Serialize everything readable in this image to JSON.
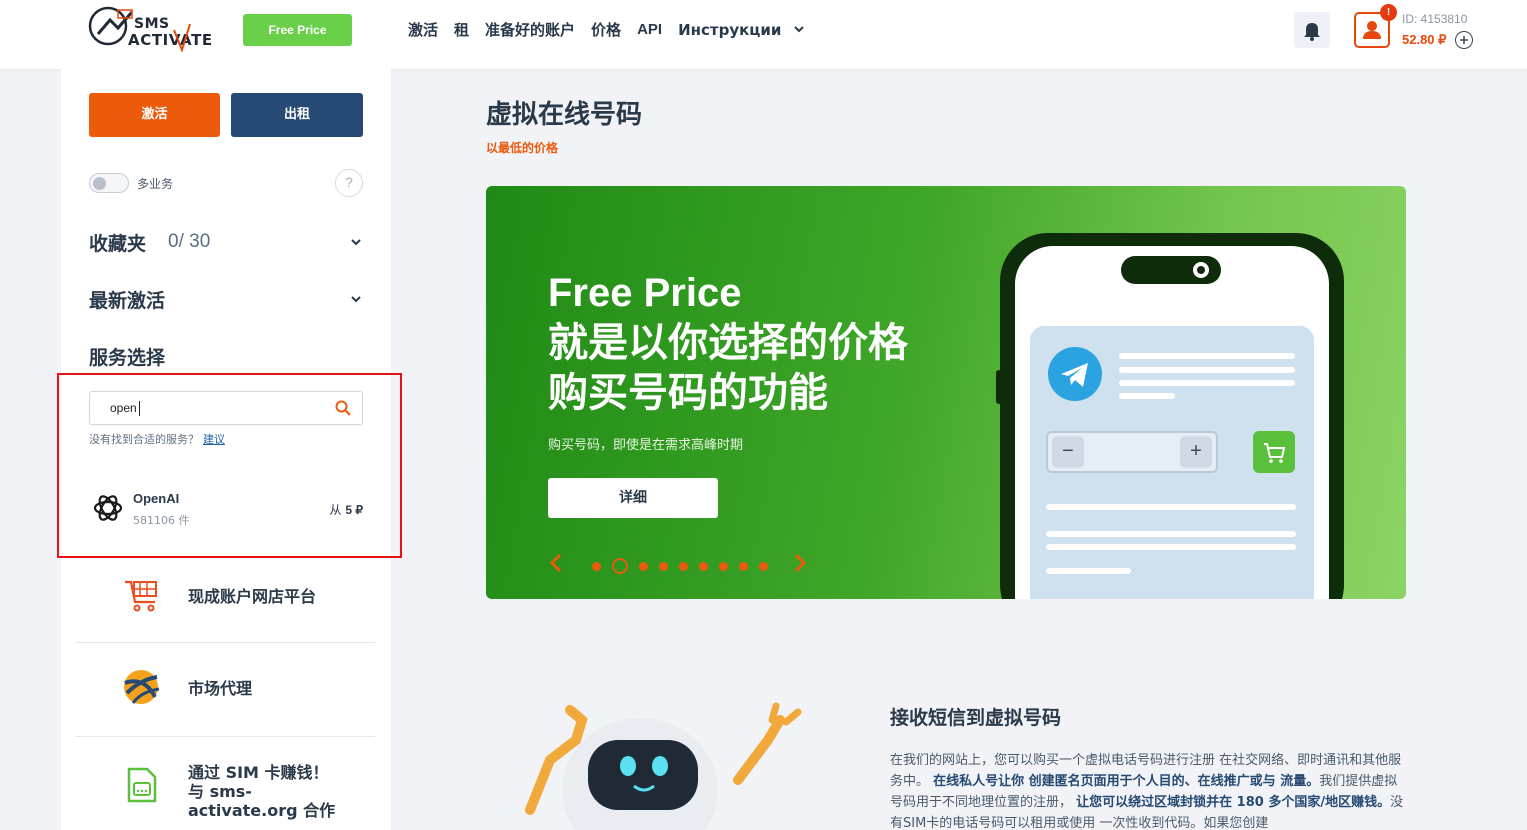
{
  "header": {
    "logo_line1": "SMS",
    "logo_line2": "ACTIVATE",
    "free_price_label": "Free Price",
    "nav": [
      "激活",
      "租",
      "准备好的账户",
      "价格",
      "API",
      "Инструкции"
    ],
    "user_id": "ID: 4153810",
    "balance": "52.80 ₽",
    "notification_badge": "!"
  },
  "sidebar": {
    "activate_label": "激活",
    "rent_label": "出租",
    "multi_service_label": "多业务",
    "help_label": "?",
    "favorites_label": "收藏夹",
    "favorites_count": "0/ 30",
    "recent_label": "最新激活",
    "service_select_label": "服务选择",
    "search_value": "open",
    "no_service_text": "没有找到合适的服务？",
    "suggest_link": "建议",
    "results": [
      {
        "name": "OpenAI",
        "count": "581106 件",
        "price_prefix": "从",
        "price": "5 ₽"
      }
    ],
    "links": [
      {
        "label": "现成账户网店平台",
        "icon": "shop-cart-icon"
      },
      {
        "label": "市场代理",
        "icon": "globe-icon"
      },
      {
        "label_lines": [
          "通过 SIM 卡赚钱！",
          "与 sms-",
          "activate.org 合作"
        ],
        "icon": "sim-card-icon"
      }
    ]
  },
  "main": {
    "title": "虚拟在线号码",
    "subtitle": "以最低的价格",
    "banner": {
      "title": "Free Price",
      "line2": "就是以你选择的价格",
      "line3": "购买号码的功能",
      "description": "购买号码，即使是在需求高峰时期",
      "button_label": "详细",
      "slides_total": 9,
      "active_slide": 2
    },
    "section2": {
      "title": "接收短信到虚拟号码",
      "text_parts": [
        "在我们的网站上，您可以购买一个虚拟电话号码进行注册 在社交网络、即时通讯和其他服务中。",
        "在线私人号让你 创建匿名页面用于个人目的、在线推广或与 流量。",
        "我们提供虚拟号码用于不同地理位置的注册，",
        "让您可以绕过区域封锁并在 180 多个国家/地区赚钱。",
        "没有SIM卡的电话号码可以租用或使用 一次性收到代码。如果您创建"
      ]
    }
  },
  "colors": {
    "accent_orange": "#ec5a0c",
    "navy": "#264a73",
    "green": "#6ad04a",
    "highlight_red": "#e8111a"
  }
}
